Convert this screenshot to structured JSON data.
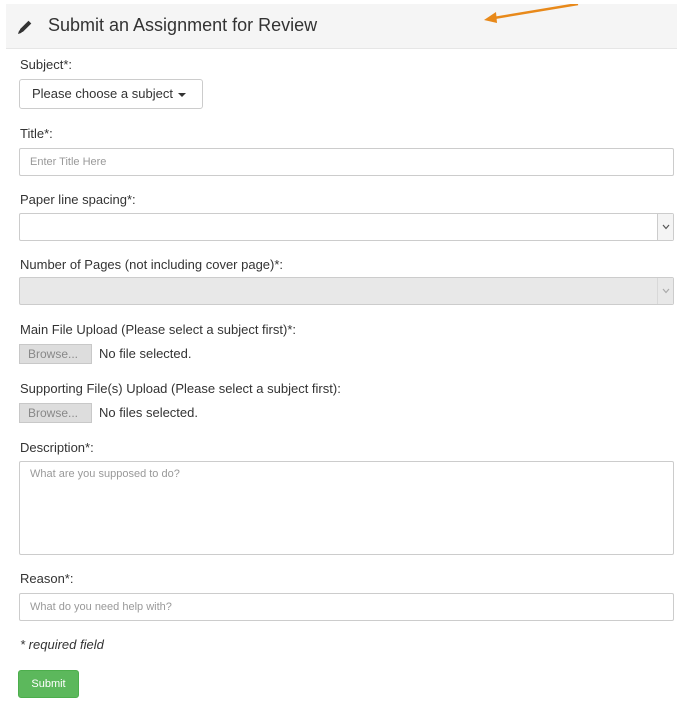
{
  "header": {
    "title": "Submit an Assignment for Review",
    "icon": "pencil-icon"
  },
  "form": {
    "subject": {
      "label": "Subject*:",
      "dropdown_label": "Please choose a subject"
    },
    "title": {
      "label": "Title*:",
      "placeholder": "Enter Title Here",
      "value": ""
    },
    "line_spacing": {
      "label": "Paper line spacing*:",
      "selected": ""
    },
    "num_pages": {
      "label": "Number of Pages (not including cover page)*:",
      "selected": ""
    },
    "main_file": {
      "label": "Main File Upload (Please select a subject first)*:",
      "browse_label": "Browse...",
      "status": "No file selected."
    },
    "supporting_files": {
      "label": "Supporting File(s) Upload (Please select a subject first):",
      "browse_label": "Browse...",
      "status": "No files selected."
    },
    "description": {
      "label": "Description*:",
      "placeholder": "What are you supposed to do?",
      "value": ""
    },
    "reason": {
      "label": "Reason*:",
      "placeholder": "What do you need help with?",
      "value": ""
    },
    "required_note": "* required field",
    "submit_label": "Submit"
  },
  "colors": {
    "submit_green": "#5cb85c",
    "arrow_orange": "#e8891a",
    "heading_bg": "#f5f5f5"
  }
}
